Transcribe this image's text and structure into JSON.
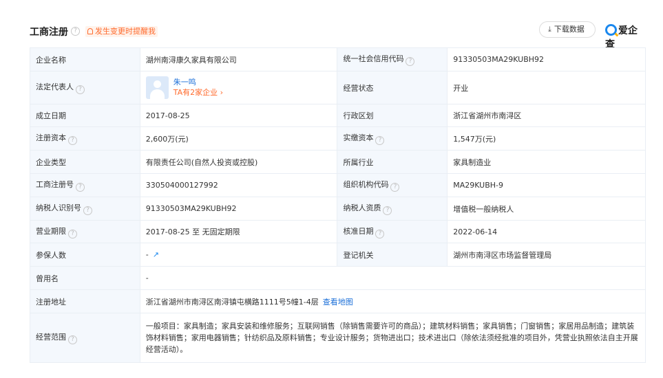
{
  "header": {
    "title": "工商注册",
    "alert": "发生变更时提醒我",
    "download_label": "下载数据",
    "logo_text": "爱企查"
  },
  "rows": {
    "company_name": {
      "label": "企业名称",
      "value": "湖州南浔康久家具有限公司"
    },
    "credit_code": {
      "label": "统一社会信用代码",
      "value": "91330503MA29KUBH92"
    },
    "legal_rep": {
      "label": "法定代表人",
      "name": "朱一鸣",
      "link": "TA有2家企业 ›"
    },
    "status": {
      "label": "经营状态",
      "value": "开业"
    },
    "found_date": {
      "label": "成立日期",
      "value": "2017-08-25"
    },
    "region": {
      "label": "行政区划",
      "value": "浙江省湖州市南浔区"
    },
    "reg_capital": {
      "label": "注册资本",
      "value": "2,600万(元)"
    },
    "paid_capital": {
      "label": "实缴资本",
      "value": "1,547万(元)"
    },
    "company_type": {
      "label": "企业类型",
      "value": "有限责任公司(自然人投资或控股)"
    },
    "industry": {
      "label": "所属行业",
      "value": "家具制造业"
    },
    "reg_number": {
      "label": "工商注册号",
      "value": "330504000127992"
    },
    "org_code": {
      "label": "组织机构代码",
      "value": "MA29KUBH-9"
    },
    "taxpayer_id": {
      "label": "纳税人识别号",
      "value": "91330503MA29KUBH92"
    },
    "taxpayer_qual": {
      "label": "纳税人资质",
      "value": "增值税一般纳税人"
    },
    "business_term": {
      "label": "营业期限",
      "value": "2017-08-25 至 无固定期限"
    },
    "approval_date": {
      "label": "核准日期",
      "value": "2022-06-14"
    },
    "insured": {
      "label": "参保人数",
      "value": "-"
    },
    "authority": {
      "label": "登记机关",
      "value": "湖州市南浔区市场监督管理局"
    },
    "former_name": {
      "label": "曾用名",
      "value": "-"
    },
    "address": {
      "label": "注册地址",
      "value": "浙江省湖州市南浔区南浔镇屯横路1111号5幢1-4层",
      "map_link": "查看地图"
    },
    "scope": {
      "label": "经营范围",
      "value": "一般项目：家具制造；家具安装和维修服务；互联网销售（除销售需要许可的商品）；建筑材料销售；家具销售；门窗销售；家居用品制造；建筑装饰材料销售；家用电器销售；针纺织品及原料销售；专业设计服务；货物进出口；技术进出口（除依法须经批准的项目外，凭营业执照依法自主开展经营活动）。"
    }
  },
  "icons": {
    "help": "question-circle-icon",
    "bell": "bell-icon",
    "download": "download-icon",
    "trend": "trend-chart-icon",
    "avatar": "person-avatar",
    "logo": "aiqicha-logo-icon"
  },
  "colors": {
    "accent_blue": "#1b6fd8",
    "alert_orange": "#ff6a2c",
    "label_bg": "#f4f8fd",
    "border": "#e9eef4"
  }
}
